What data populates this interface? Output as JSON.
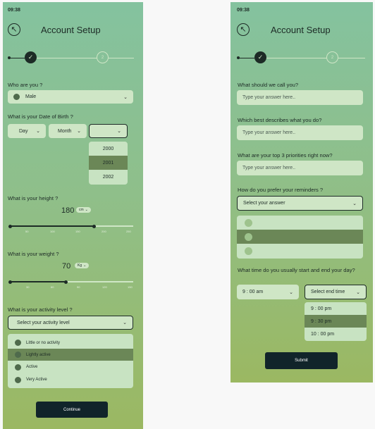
{
  "screen1": {
    "status_time": "09:38",
    "title": "Account Setup",
    "step2_label": "2",
    "gender": {
      "question": "Who are you ?",
      "value": "Male"
    },
    "dob": {
      "question": "What is your Date of Birth ?",
      "day": "Day",
      "month": "Month",
      "year_options": [
        "2000",
        "2001",
        "2002"
      ],
      "selected_year": "2001"
    },
    "height": {
      "question": "What is your height ?",
      "value": "180",
      "unit": "cm",
      "ticks": [
        "50",
        "100",
        "150",
        "200",
        "250"
      ],
      "fill_fraction": 0.68
    },
    "weight": {
      "question": "What is your weight ?",
      "value": "70",
      "unit": "Kg",
      "ticks": [
        "30",
        "60",
        "90",
        "120",
        "150"
      ],
      "fill_fraction": 0.45
    },
    "activity": {
      "question": "What is your activity level ?",
      "placeholder": "Select your activity level",
      "options": [
        "Little or no activity",
        "Lightly active",
        "Active",
        "Very Active"
      ],
      "selected": "Lightly active"
    },
    "continue_label": "Continue"
  },
  "screen2": {
    "status_time": "09:38",
    "title": "Account Setup",
    "step2_label": "2",
    "name_question": "What should we call you?",
    "describe_question": "Which best describes what you do?",
    "priorities_question": "What are your top 3 priorities right now?",
    "input_placeholder": "Type your answer here..",
    "reminders": {
      "question": "How do you prefer your reminders ?",
      "placeholder": "Select your answer"
    },
    "day_time": {
      "question": "What time do you usually start and end your day?",
      "start_value": "9 : 00 am",
      "end_placeholder": "Select end time",
      "options": [
        "9 : 00 pm",
        "9 : 30 pm",
        "10 : 00 pm"
      ],
      "selected": "9 : 30 pm"
    },
    "submit_label": "Submit"
  },
  "colors": {
    "dark": "#1d2b26",
    "field": "#cfe6c6",
    "selected_row": "#6b8757",
    "button": "#11242a"
  },
  "icons": [
    "back-arrow-icon",
    "check-icon",
    "chevron-down-icon",
    "person-icon"
  ]
}
